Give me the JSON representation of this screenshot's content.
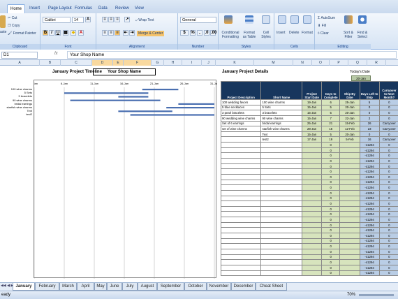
{
  "ribbon": {
    "tabs": [
      "Home",
      "Insert",
      "Page Layout",
      "Formulas",
      "Data",
      "Review",
      "View"
    ],
    "clipboard": {
      "cut": "Cut",
      "copy": "Copy",
      "format_painter": "Format Painter",
      "paste": "aste",
      "label": "Clipboard"
    },
    "font": {
      "name": "Calibri",
      "size": "14",
      "label": "Font"
    },
    "alignment": {
      "wrap": "Wrap Text",
      "merge": "Merge & Center",
      "label": "Alignment"
    },
    "number": {
      "format": "General",
      "label": "Number",
      "percent": "%",
      "comma": ","
    },
    "styles": {
      "conditional": "Conditional Formatting",
      "format_table": "Format as Table",
      "cell_styles": "Cell Styles",
      "label": "Styles"
    },
    "cells": {
      "insert": "Insert",
      "delete": "Delete",
      "format": "Format",
      "label": "Cells"
    },
    "editing": {
      "autosum": "AutoSum",
      "fill": "Fill",
      "clear": "Clear",
      "sort": "Sort & Filter",
      "find": "Find & Select",
      "label": "Editing"
    }
  },
  "formula_bar": {
    "cell_ref": "D1",
    "fx": "fx",
    "content": "Your Shop Name"
  },
  "columns": [
    {
      "l": "A",
      "w": 57
    },
    {
      "l": "B",
      "w": 30
    },
    {
      "l": "C",
      "w": 45
    },
    {
      "l": "D",
      "w": 30
    },
    {
      "l": "E",
      "w": 15
    },
    {
      "l": "F",
      "w": 40
    },
    {
      "l": "G",
      "w": 18
    },
    {
      "l": "H",
      "w": 26
    },
    {
      "l": "I",
      "w": 28
    },
    {
      "l": "J",
      "w": 20
    },
    {
      "l": "K",
      "w": 55
    },
    {
      "l": "M",
      "w": 56
    },
    {
      "l": "N",
      "w": 27
    },
    {
      "l": "O",
      "w": 25
    },
    {
      "l": "P",
      "w": 27
    },
    {
      "l": "Q",
      "w": 27
    },
    {
      "l": "R",
      "w": 27
    }
  ],
  "timeline": {
    "title": "January Project Timeline",
    "shop_name": "Your Shop Name",
    "dates": [
      "1-Jan",
      "6-Jan",
      "11-Jan",
      "16-Jan",
      "21-Jan",
      "26-Jan",
      "31-Jan"
    ],
    "axis_min": 1,
    "axis_max": 31,
    "tasks": [
      {
        "name": "100 wine charms",
        "start": 19,
        "end": 25
      },
      {
        "name": "5 Sets",
        "start": 6,
        "end": 20
      },
      {
        "name": "3 bracelets",
        "start": 15,
        "end": 20
      },
      {
        "name": "90 wine charms",
        "start": 7,
        "end": 22
      },
      {
        "name": "bridal earrings",
        "start": 25,
        "end": 31
      },
      {
        "name": "starfish wine charms",
        "start": 23,
        "end": 31
      },
      {
        "name": "Text",
        "start": 15,
        "end": 24
      },
      {
        "name": "test2",
        "start": 17,
        "end": 31
      }
    ]
  },
  "details": {
    "title": "January Project Details",
    "today_label": "Today's Date",
    "today": "20-Jan",
    "headers": [
      "Project Description",
      "Short Name",
      "Project Start Date",
      "Days to Complete",
      "Ship By Date",
      "Days Left to Ship",
      "Carryover to Next Month?"
    ],
    "rows": [
      [
        "100 wedding favors",
        "100 wine charms",
        "19-Jan",
        "6",
        "25-Jan",
        "5",
        "0"
      ],
      [
        "5 blue necklaces",
        "5 Sets",
        "15-Jan",
        "5",
        "20-Jan",
        "0",
        "0"
      ],
      [
        "3 pearl bracelets",
        "3 bracelets",
        "15-Jan",
        "5",
        "20-Jan",
        "0",
        "0"
      ],
      [
        "90 wedding wine charms",
        "90 wine charms",
        "15-Jan",
        "7",
        "22-Jan",
        "2",
        "0"
      ],
      [
        "Set of 6 earrings",
        "bridal earrings",
        "25-Jan",
        "21",
        "15-Feb",
        "26",
        "Carryover"
      ],
      [
        "set of wine charms",
        "starfish wine charms",
        "28-Jan",
        "15",
        "12-Feb",
        "23",
        "Carryover"
      ],
      [
        "",
        "Text",
        "15-Jan",
        "5",
        "20-Jan",
        "0",
        "0"
      ],
      [
        "",
        "test2",
        "17-Jan",
        "19",
        "5-Feb",
        "16",
        "Carryover"
      ]
    ],
    "empty_rows": {
      "days": "0",
      "left": "-41294",
      "carry": "0"
    }
  },
  "sheet_tabs": [
    "January",
    "February",
    "March",
    "April",
    "May",
    "June",
    "July",
    "August",
    "September",
    "October",
    "November",
    "December",
    "Cheat Sheet"
  ],
  "status": {
    "left": "eady",
    "zoom": "70%"
  }
}
